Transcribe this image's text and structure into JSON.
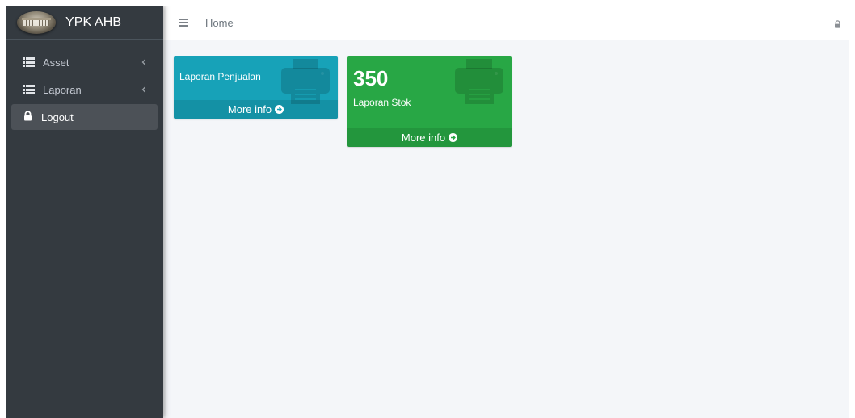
{
  "brand": {
    "name": "YPK AHB",
    "logo": "building-photo-logo"
  },
  "sidebar": {
    "items": [
      {
        "label": "Asset",
        "icon": "list-icon",
        "chevron": "chevron-left-icon"
      },
      {
        "label": "Laporan",
        "icon": "list-icon",
        "chevron": "chevron-left-icon"
      },
      {
        "label": "Logout",
        "icon": "lock-icon",
        "active": true
      }
    ]
  },
  "topbar": {
    "menu_icon": "hamburger-icon",
    "home_label": "Home",
    "right_icon": "lock-icon"
  },
  "boxes": [
    {
      "value": "",
      "label": "Laporan Penjualan",
      "footer": "More info",
      "icon": "printer-icon",
      "color": "#17a2b8"
    },
    {
      "value": "350",
      "label": "Laporan Stok",
      "footer": "More info",
      "icon": "printer-icon",
      "color": "#28a745"
    }
  ],
  "colors": {
    "sidebar": "#343a40",
    "content_bg": "#f4f6f9",
    "info": "#17a2b8",
    "success": "#28a745"
  }
}
